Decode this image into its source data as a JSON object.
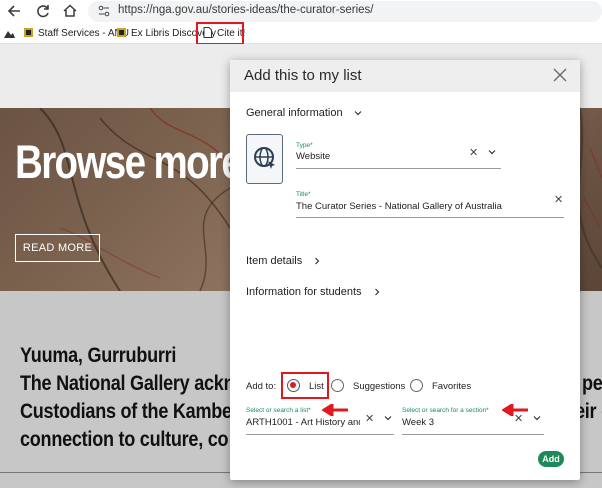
{
  "browser": {
    "url": "https://nga.gov.au/stories-ideas/the-curator-series/",
    "bookmarks": [
      {
        "label": "Staff Services - ANU"
      },
      {
        "label": "Ex Libris Discovery"
      },
      {
        "label": "Cite it!"
      }
    ]
  },
  "page": {
    "hero_title": "Browse more",
    "read_more": "READ MORE",
    "ack_lines": [
      "Yuuma, Gurruburri",
      "The National Gallery ackn",
      "Custodians of the Kambe",
      "connection to culture, co"
    ],
    "ack_right": [
      "pec",
      "eir c"
    ]
  },
  "dialog": {
    "title": "Add this to my list",
    "general_info": "General information",
    "type_label": "Type*",
    "type_value": "Website",
    "title_label": "Title*",
    "title_value": "The Curator Series - National Gallery of Australia",
    "item_details": "Item details",
    "info_students": "Information for students",
    "add_to": "Add to:",
    "options": [
      "List",
      "Suggestions",
      "Favorites"
    ],
    "list_field_label": "Select or search a list*",
    "list_field_value": "ARTH1001 - Art History and",
    "section_field_label": "Select or search for a section*",
    "section_field_value": "Week 3",
    "add_button": "Add"
  },
  "colors": {
    "accent_green": "#1e8a5a",
    "highlight_red": "#e0191f"
  }
}
